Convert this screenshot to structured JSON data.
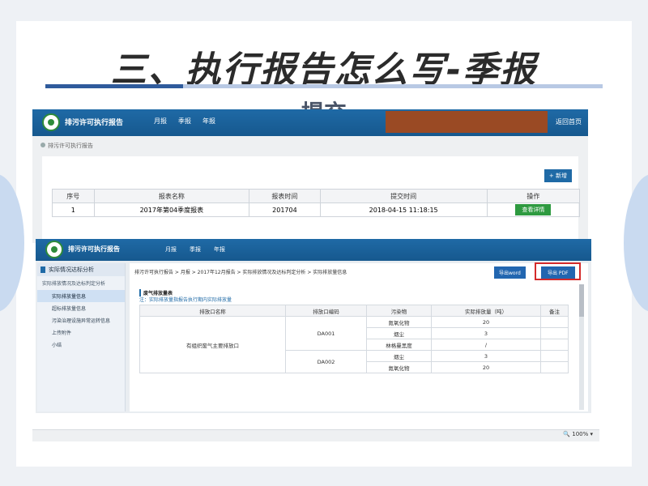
{
  "slide": {
    "title": "三、执行报告怎么写-季报",
    "subtitle": "提交"
  },
  "shot1": {
    "app_title": "排污许可执行报告",
    "nav": [
      "月报",
      "季报",
      "年报"
    ],
    "home": "返回首页",
    "breadcrumb": "排污许可执行报告",
    "new_button": "+ 新增",
    "columns": [
      "序号",
      "报表名称",
      "报表时间",
      "提交时间",
      "操作"
    ],
    "row": {
      "index": "1",
      "name": "2017年第04季度报表",
      "period": "201704",
      "submitted": "2018-04-15 11:18:15",
      "action": "查看详情"
    }
  },
  "shot2": {
    "app_title": "排污许可执行报告",
    "nav": [
      "月报",
      "季报",
      "年报"
    ],
    "sidebar": {
      "header": "实际情况达标分析",
      "sub": "实际排放情况及达标判定分析",
      "items": [
        "实际排放量信息",
        "超标排放量信息",
        "污染治理设施异常运转信息",
        "上传附件",
        "小结"
      ],
      "active_index": 0
    },
    "breadcrumb": "排污许可执行报告 > 月报 > 2017年12月报告 > 实际排放情况及达标判定分析 > 实际排放量信息",
    "export_word": "导出word",
    "export_pdf": "导出 PDF",
    "section_title": "废气排放量表",
    "note": "注：实际排放量指报告执行期内实际排放量",
    "columns": [
      "排放口名称",
      "排放口编码",
      "污染物",
      "实际排放量（吨）",
      "备注"
    ],
    "outlet_name": "有组织废气主要排放口",
    "outlets": [
      {
        "code": "DA001",
        "rows": [
          [
            "氮氧化物",
            "20"
          ],
          [
            "烟尘",
            "3"
          ],
          [
            "林格曼黑度",
            "/"
          ]
        ]
      },
      {
        "code": "DA002",
        "rows": [
          [
            "烟尘",
            "3"
          ],
          [
            "氮氧化物",
            "20"
          ]
        ]
      }
    ]
  },
  "statusbar": {
    "zoom": "100%"
  },
  "colors": {
    "nav": "#1f6aa6",
    "view_button": "#2e9a40",
    "highlight": "#d42a2a",
    "redaction": "#9a4a24"
  }
}
